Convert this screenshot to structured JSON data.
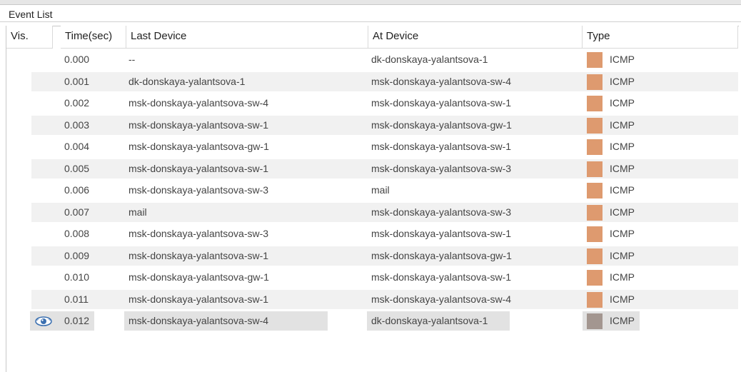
{
  "panel": {
    "title": "Event List"
  },
  "columns": {
    "vis": "Vis.",
    "time": "Time(sec)",
    "last": "Last Device",
    "at": "At Device",
    "type": "Type"
  },
  "colors": {
    "icmp": "#de9a6f",
    "icmp_selected": "#a39690",
    "row_alt": "#f1f1f1",
    "selection": "#e2e2e2"
  },
  "rows": [
    {
      "time": "0.000",
      "last": "--",
      "at": "dk-donskaya-yalantsova-1",
      "type": "ICMP"
    },
    {
      "time": "0.001",
      "last": "dk-donskaya-yalantsova-1",
      "at": "msk-donskaya-yalantsova-sw-4",
      "type": "ICMP"
    },
    {
      "time": "0.002",
      "last": "msk-donskaya-yalantsova-sw-4",
      "at": "msk-donskaya-yalantsova-sw-1",
      "type": "ICMP"
    },
    {
      "time": "0.003",
      "last": "msk-donskaya-yalantsova-sw-1",
      "at": "msk-donskaya-yalantsova-gw-1",
      "type": "ICMP"
    },
    {
      "time": "0.004",
      "last": "msk-donskaya-yalantsova-gw-1",
      "at": "msk-donskaya-yalantsova-sw-1",
      "type": "ICMP"
    },
    {
      "time": "0.005",
      "last": "msk-donskaya-yalantsova-sw-1",
      "at": "msk-donskaya-yalantsova-sw-3",
      "type": "ICMP"
    },
    {
      "time": "0.006",
      "last": "msk-donskaya-yalantsova-sw-3",
      "at": "mail",
      "type": "ICMP"
    },
    {
      "time": "0.007",
      "last": "mail",
      "at": "msk-donskaya-yalantsova-sw-3",
      "type": "ICMP"
    },
    {
      "time": "0.008",
      "last": "msk-donskaya-yalantsova-sw-3",
      "at": "msk-donskaya-yalantsova-sw-1",
      "type": "ICMP"
    },
    {
      "time": "0.009",
      "last": "msk-donskaya-yalantsova-sw-1",
      "at": "msk-donskaya-yalantsova-gw-1",
      "type": "ICMP"
    },
    {
      "time": "0.010",
      "last": "msk-donskaya-yalantsova-gw-1",
      "at": "msk-donskaya-yalantsova-sw-1",
      "type": "ICMP"
    },
    {
      "time": "0.011",
      "last": "msk-donskaya-yalantsova-sw-1",
      "at": "msk-donskaya-yalantsova-sw-4",
      "type": "ICMP"
    },
    {
      "time": "0.012",
      "last": "msk-donskaya-yalantsova-sw-4",
      "at": "dk-donskaya-yalantsova-1",
      "type": "ICMP",
      "selected": true,
      "vis_icon": "eye-icon"
    }
  ]
}
